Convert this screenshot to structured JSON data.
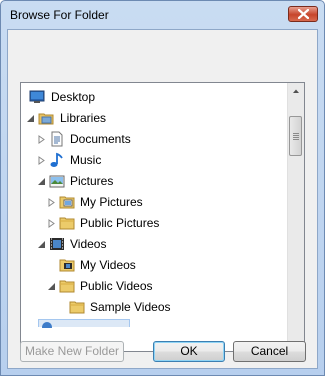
{
  "window": {
    "title": "Browse For Folder"
  },
  "tree": {
    "items": [
      {
        "label": "Desktop",
        "icon": "desktop-icon",
        "expander": "none"
      },
      {
        "label": "Libraries",
        "icon": "libraries-icon",
        "expander": "expanded"
      },
      {
        "label": "Documents",
        "icon": "documents-icon",
        "expander": "collapsed"
      },
      {
        "label": "Music",
        "icon": "music-icon",
        "expander": "collapsed"
      },
      {
        "label": "Pictures",
        "icon": "pictures-icon",
        "expander": "expanded"
      },
      {
        "label": "My Pictures",
        "icon": "my-pictures-icon",
        "expander": "collapsed"
      },
      {
        "label": "Public Pictures",
        "icon": "folder-icon",
        "expander": "collapsed"
      },
      {
        "label": "Videos",
        "icon": "videos-icon",
        "expander": "expanded"
      },
      {
        "label": "My Videos",
        "icon": "my-videos-icon",
        "expander": "none"
      },
      {
        "label": "Public Videos",
        "icon": "folder-icon",
        "expander": "expanded"
      },
      {
        "label": "Sample Videos",
        "icon": "folder-icon",
        "expander": "none"
      }
    ]
  },
  "buttons": {
    "new_folder": "Make New Folder",
    "ok": "OK",
    "cancel": "Cancel"
  },
  "colors": {
    "frame": "#b9d1ea",
    "client": "#f0f0f0",
    "selection": "#dce8f6",
    "close": "#c7452c"
  }
}
